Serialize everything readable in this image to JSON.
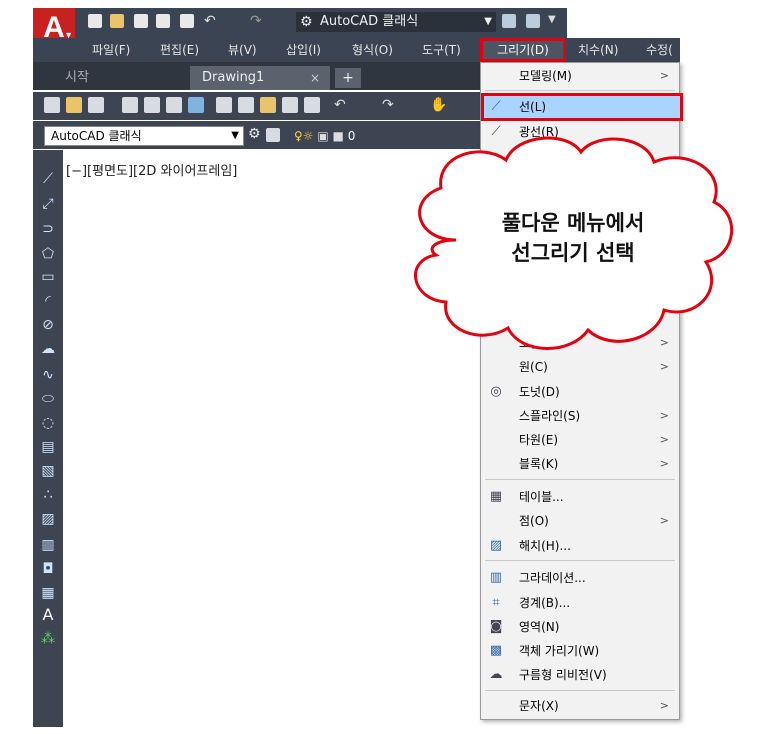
{
  "app": {
    "logo_letter": "A",
    "workspace_name": "AutoCAD 클래식"
  },
  "menubar": {
    "items": [
      "파일(F)",
      "편집(E)",
      "뷰(V)",
      "삽입(I)",
      "형식(O)",
      "도구(T)",
      "그리기(D)",
      "치수(N)",
      "수정("
    ],
    "active": "그리기(D)"
  },
  "tabs": {
    "start": "시작",
    "drawing": "Drawing1",
    "close": "×",
    "add": "+"
  },
  "toolbar": {
    "workspace_select": "AutoCAD 클래식",
    "layer_value": "0"
  },
  "viewport": {
    "label": "[−][평면도][2D 와이어프레임]"
  },
  "draw_menu": {
    "items": [
      {
        "label": "모델링(M)",
        "submenu": true,
        "icon": ""
      },
      {
        "label": "선(L)",
        "submenu": false,
        "icon": "line-icon",
        "highlighted": true
      },
      {
        "label": "광선(R)",
        "submenu": false,
        "icon": "ray-icon"
      },
      {
        "label": "호(A)",
        "submenu": true,
        "icon": ""
      },
      {
        "label": "원(C)",
        "submenu": true,
        "icon": ""
      },
      {
        "label": "도넛(D)",
        "submenu": false,
        "icon": "donut-icon"
      },
      {
        "label": "스플라인(S)",
        "submenu": true,
        "icon": ""
      },
      {
        "label": "타원(E)",
        "submenu": true,
        "icon": ""
      },
      {
        "label": "블록(K)",
        "submenu": true,
        "icon": ""
      },
      {
        "label": "테이블...",
        "submenu": false,
        "icon": "table-icon"
      },
      {
        "label": "점(O)",
        "submenu": true,
        "icon": ""
      },
      {
        "label": "해치(H)...",
        "submenu": false,
        "icon": "hatch-icon"
      },
      {
        "label": "그라데이션...",
        "submenu": false,
        "icon": "gradient-icon"
      },
      {
        "label": "경계(B)...",
        "submenu": false,
        "icon": "boundary-icon"
      },
      {
        "label": "영역(N)",
        "submenu": false,
        "icon": "region-icon"
      },
      {
        "label": "객체 가리기(W)",
        "submenu": false,
        "icon": "wipeout-icon"
      },
      {
        "label": "구름형 리비전(V)",
        "submenu": false,
        "icon": "revcloud-icon"
      },
      {
        "label": "문자(X)",
        "submenu": true,
        "icon": ""
      }
    ],
    "submenu_arrow": ">"
  },
  "callout": {
    "line1": "풀다운 메뉴에서",
    "line2": "선그리기 선택"
  },
  "colors": {
    "highlight_border": "#e3000f",
    "highlight_fill": "#a8d4ff",
    "dark_ui": "#3b4453"
  }
}
